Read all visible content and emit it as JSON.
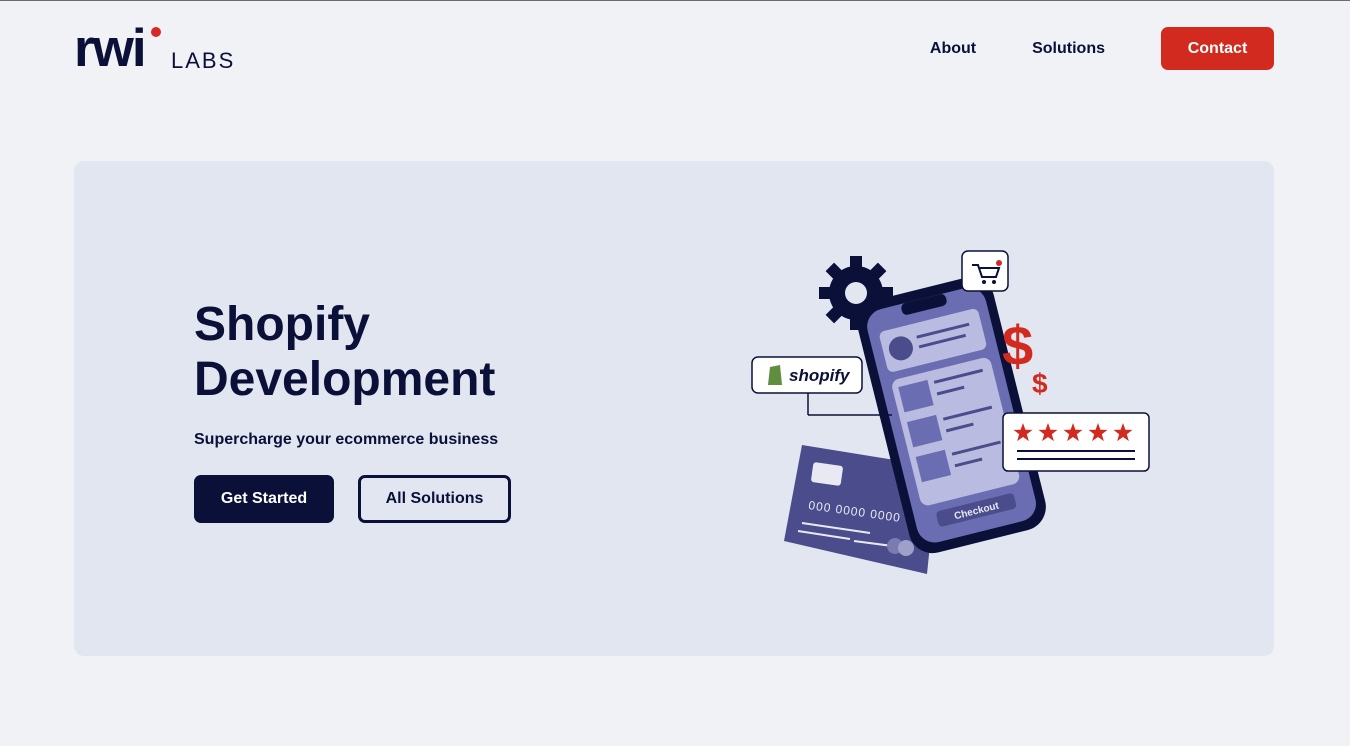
{
  "brand": {
    "logo_main": "rwi",
    "logo_sub": "LABS",
    "accent": "#d32a1f",
    "navy": "#0b1038"
  },
  "nav": {
    "items": [
      "About",
      "Solutions"
    ],
    "contact_label": "Contact"
  },
  "hero": {
    "title": "Shopify Development",
    "subtitle": "Supercharge your ecommerce business",
    "primary_cta": "Get Started",
    "secondary_cta": "All Solutions"
  },
  "illustration": {
    "shopify_label": "shopify",
    "checkout_label": "Checkout",
    "card_number": "000 0000 0000",
    "rating_stars": 5,
    "icons": [
      "gear-icon",
      "cart-icon",
      "dollar-icon",
      "star-icon",
      "credit-card-icon",
      "smartphone-icon"
    ]
  }
}
